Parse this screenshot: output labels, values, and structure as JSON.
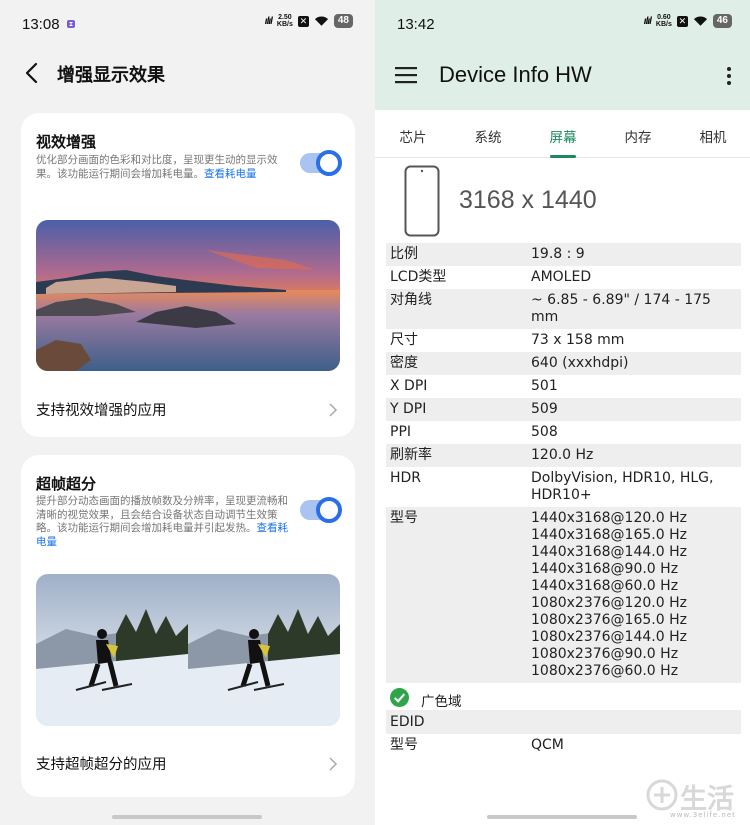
{
  "left": {
    "status": {
      "time": "13:08",
      "speed_value": "2.50",
      "speed_unit": "KB/s",
      "battery": "48"
    },
    "title": "增强显示效果",
    "card1": {
      "title": "视效增强",
      "desc": "优化部分画面的色彩和对比度，呈现更生动的显示效果。该功能运行期间会增加耗电量。",
      "link": "查看耗电量",
      "toggle_on": true,
      "row_label": "支持视效增强的应用"
    },
    "card2": {
      "title": "超帧超分",
      "desc": "提升部分动态画面的播放帧数及分辨率，呈现更流畅和清晰的视觉效果，且会结合设备状态自动调节生效策略。该功能运行期间会增加耗电量并引起发热。",
      "link": "查看耗电量",
      "toggle_on": true,
      "row_label": "支持超帧超分的应用"
    }
  },
  "right": {
    "status": {
      "time": "13:42",
      "speed_value": "0.60",
      "speed_unit": "KB/s",
      "battery": "46"
    },
    "app_title": "Device Info HW",
    "tabs": [
      "芯片",
      "系统",
      "屏幕",
      "内存",
      "相机"
    ],
    "active_tab": 2,
    "resolution": "3168 x 1440",
    "rows": [
      {
        "k": "比例",
        "v": "19.8 : 9"
      },
      {
        "k": "LCD类型",
        "v": "AMOLED"
      },
      {
        "k": "对角线",
        "v": "~ 6.85 - 6.89\" / 174 - 175 mm"
      },
      {
        "k": "尺寸",
        "v": "73 x 158 mm"
      },
      {
        "k": "密度",
        "v": "640 (xxxhdpi)"
      },
      {
        "k": "X DPI",
        "v": "501"
      },
      {
        "k": "Y DPI",
        "v": "509"
      },
      {
        "k": "PPI",
        "v": "508"
      },
      {
        "k": "刷新率",
        "v": "120.0 Hz"
      },
      {
        "k": "HDR",
        "v": "DolbyVision, HDR10, HLG,\nHDR10+"
      },
      {
        "k": "型号",
        "v": "1440x3168@120.0 Hz\n1440x3168@165.0 Hz\n1440x3168@144.0 Hz\n1440x3168@90.0 Hz\n1440x3168@60.0 Hz\n1080x2376@120.0 Hz\n1080x2376@165.0 Hz\n1080x2376@144.0 Hz\n1080x2376@90.0 Hz\n1080x2376@60.0 Hz"
      }
    ],
    "wide_gamut": "广色域",
    "edid_header": "EDID",
    "edid_rows": [
      {
        "k": "型号",
        "v": "QCM"
      }
    ]
  },
  "watermark": {
    "text": "生活",
    "url": "www.3elife.net"
  },
  "colors": {
    "accent_blue": "#2a6fe8",
    "tab_active": "#1b8a5f",
    "appbar_bg": "#dfeee6",
    "check_green": "#2fa54a"
  }
}
